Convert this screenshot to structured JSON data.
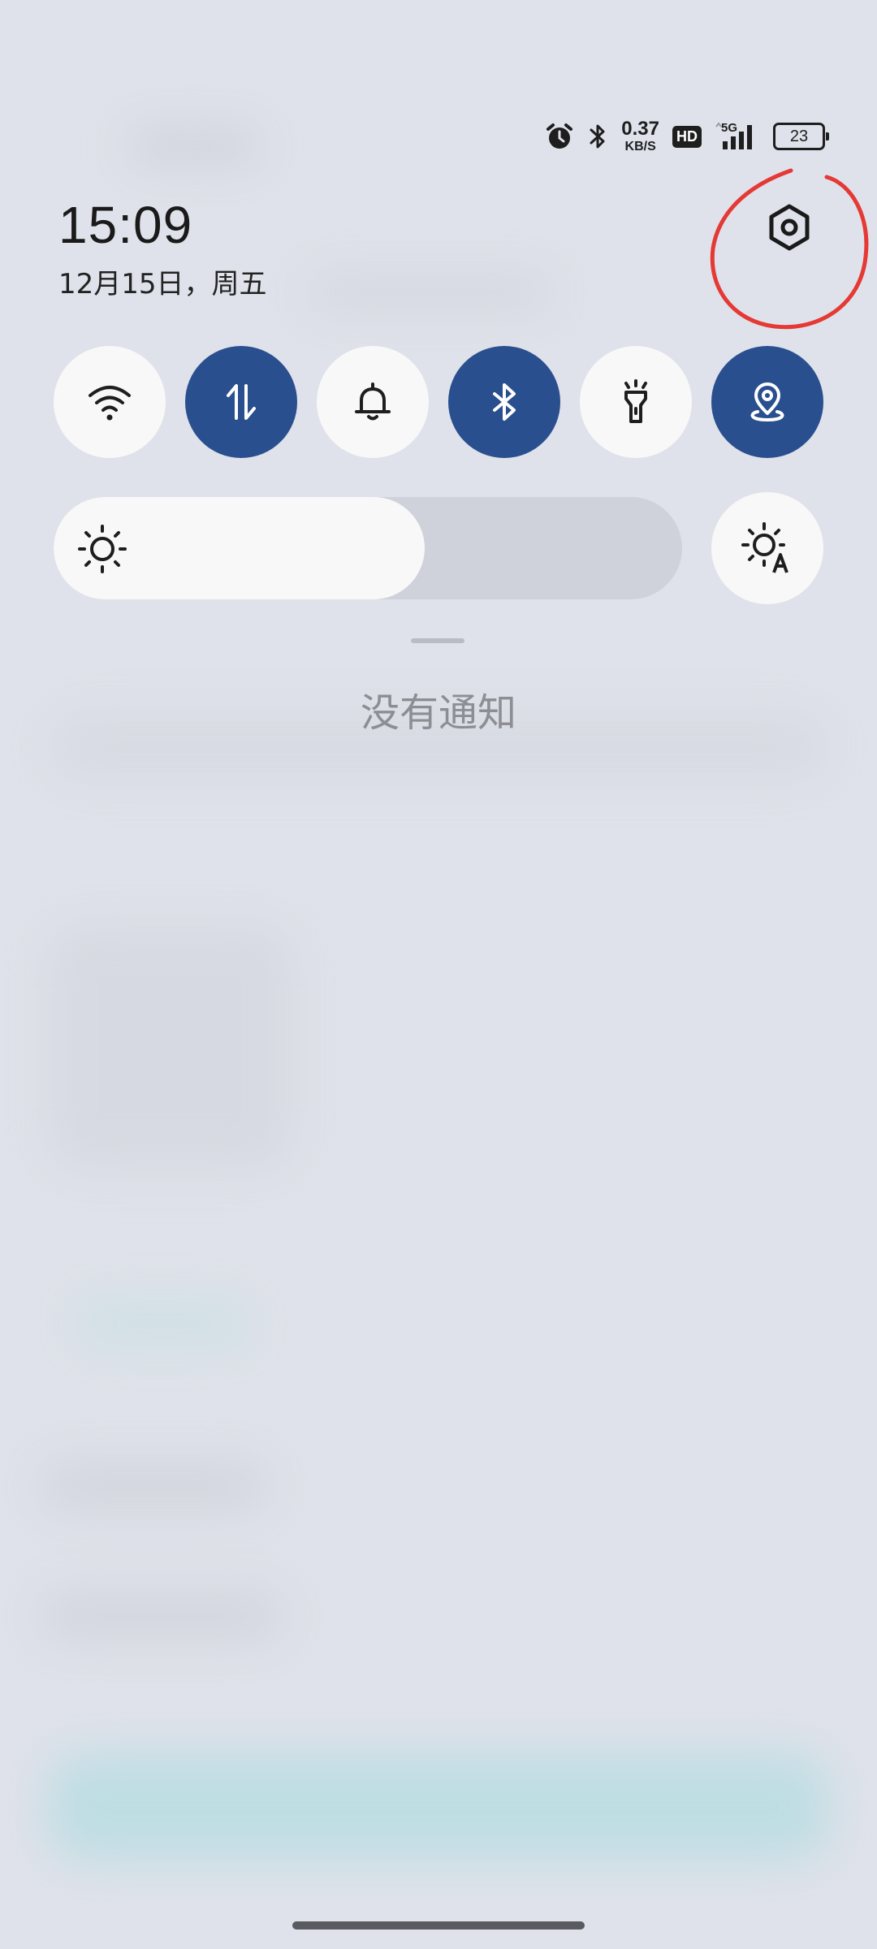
{
  "status_bar": {
    "alarm_icon": "alarm-clock-icon",
    "bluetooth_icon": "bluetooth-icon",
    "net_speed_value": "0.37",
    "net_speed_unit": "KB/S",
    "hd_label": "HD",
    "network_label": "5G",
    "battery_level": "23"
  },
  "header": {
    "time": "15:09",
    "date": "12月15日，周五",
    "settings_icon": "settings-gear-icon",
    "annotation_color": "#e53935"
  },
  "quick_toggles": [
    {
      "name": "wifi",
      "icon": "wifi-icon",
      "active": false
    },
    {
      "name": "mobile-data",
      "icon": "data-arrows-icon",
      "active": true
    },
    {
      "name": "ring-mode",
      "icon": "bell-icon",
      "active": false
    },
    {
      "name": "bluetooth",
      "icon": "bluetooth-icon",
      "active": true
    },
    {
      "name": "flashlight",
      "icon": "flashlight-icon",
      "active": false
    },
    {
      "name": "location",
      "icon": "location-pin-icon",
      "active": true
    }
  ],
  "brightness": {
    "level_percent": 59,
    "icon": "sun-icon",
    "auto_icon": "auto-brightness-icon"
  },
  "notifications": {
    "empty_text": "没有通知"
  },
  "colors": {
    "accent": "#2a4f8e",
    "toggle_off": "#f8f8f9",
    "panel_bg": "#dfe2ea"
  }
}
